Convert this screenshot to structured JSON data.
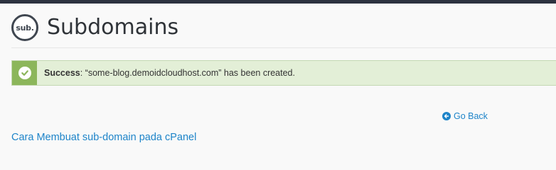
{
  "header": {
    "logo_text": "sub.",
    "title": "Subdomains"
  },
  "alert": {
    "type": "success",
    "label": "Success",
    "message": ": “some-blog.demoidcloudhost.com” has been created.",
    "icon": "check-circle-icon",
    "accent_color": "#8cb65b",
    "background_color": "#e3efd7"
  },
  "nav": {
    "go_back_label": "Go Back",
    "go_back_icon": "arrow-left-circle-icon"
  },
  "help": {
    "link_text": "Cara Membuat sub-domain pada cPanel"
  },
  "colors": {
    "link": "#1d84c9",
    "top_bar": "#2d3340"
  }
}
